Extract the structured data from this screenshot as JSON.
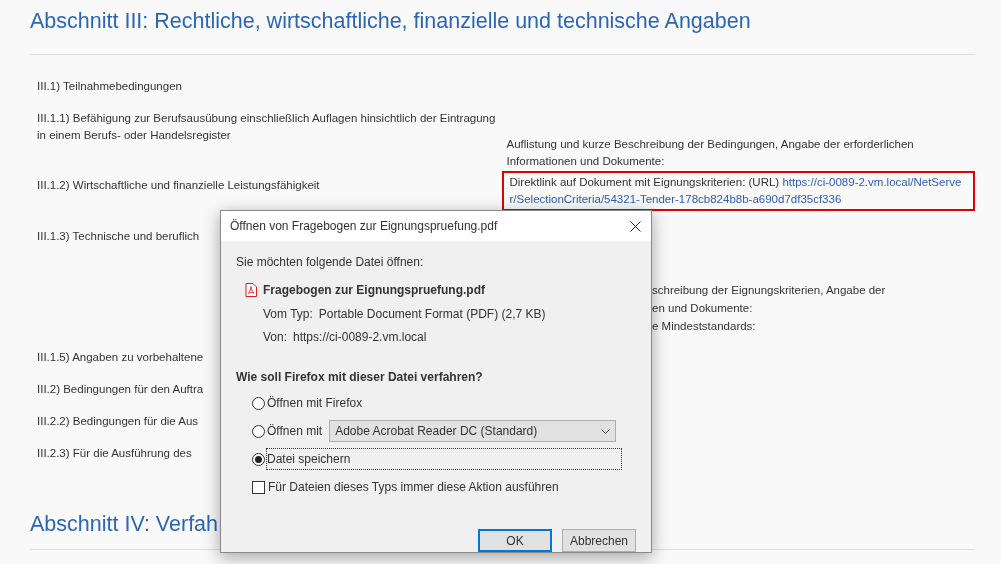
{
  "page": {
    "heading": "Abschnitt III: Rechtliche, wirtschaftliche, finanzielle und technische Angaben",
    "rows": [
      {
        "left": "III.1) Teilnahmebedingungen"
      },
      {
        "left": "III.1.1) Befähigung zur Berufsausübung einschließlich Auflagen hinsichtlich der Eintragung in einem Berufs- oder Handelsregister",
        "right": "Auflistung und kurze Beschreibung der Bedingungen, Angabe der erforderlichen Informationen und Dokumente:"
      },
      {
        "left": "III.1.2) Wirtschaftliche und finanzielle Leistungsfähigkeit",
        "right": "Direktlink auf Dokument mit Eignungskriterien: (URL)",
        "link": "https://ci-0089-2.vm.local/NetServer/SelectionCriteria/54321-Tender-178cb824b8b-a690d7df35cf336",
        "highlighted": true
      },
      {
        "left": "III.1.3) Technische und beruflich"
      }
    ],
    "covered_lines": [
      "schreibung der Eignungskriterien, Angabe der",
      "en und Dokumente:",
      "e Mindeststandards:"
    ],
    "more_rows": [
      "III.1.5) Angaben zu vorbehaltene",
      "III.2) Bedingungen für den Auftra",
      "III.2.2) Bedingungen für die Aus",
      "III.2.3) Für die Ausführung des"
    ],
    "next_heading": "Abschnitt IV: Verfah"
  },
  "dialog": {
    "title": "Öffnen von Fragebogen zur Eignungspruefung.pdf",
    "intro": "Sie möchten folgende Datei öffnen:",
    "file_name": "Fragebogen zur Eignungspruefung.pdf",
    "type_label": "Vom Typ:",
    "type_value": "Portable Document Format (PDF) (2,7 KB)",
    "from_label": "Von:",
    "from_value": "https://ci-0089-2.vm.local",
    "question": "Wie soll Firefox mit dieser Datei verfahren?",
    "options": [
      {
        "kind": "plain",
        "label": "Öffnen mit Firefox",
        "selected": false,
        "focused": false
      },
      {
        "kind": "app",
        "label": "Öffnen mit",
        "app": "Adobe Acrobat Reader DC (Standard)",
        "selected": false,
        "focused": false
      },
      {
        "kind": "plain",
        "label": "Datei speichern",
        "selected": true,
        "focused": true
      }
    ],
    "remember": {
      "label": "Für Dateien dieses Typs immer diese Aktion ausführen",
      "checked": false
    },
    "buttons": [
      {
        "label": "OK",
        "default": true
      },
      {
        "label": "Abbrechen",
        "default": false
      }
    ]
  }
}
